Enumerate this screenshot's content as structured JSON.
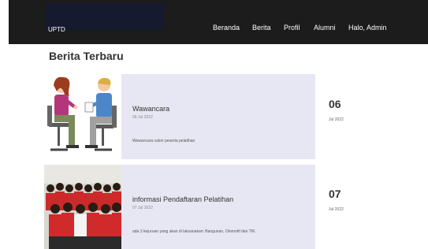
{
  "navbar": {
    "brand": "UPTD",
    "links": [
      "Beranda",
      "Berita",
      "Profil",
      "Alumni",
      "Halo, Admin"
    ]
  },
  "main": {
    "title": "Berita Terbaru",
    "news": [
      {
        "title": "Wawancara",
        "date": "06 Jul 2022",
        "description": "Wawancara calon peserta pelatihan",
        "day": "06",
        "month": "Jul 2022",
        "image": "interview-illustration"
      },
      {
        "title": "informasi Pendaftaran Pelatihan",
        "date": "07 Jul 2022",
        "description": "ada 3 kejuruan yang akan di laksanakan: Bangunan, Otomotif dan TIK.",
        "day": "07",
        "month": "Jul 2022",
        "image": "group-photo"
      }
    ]
  }
}
